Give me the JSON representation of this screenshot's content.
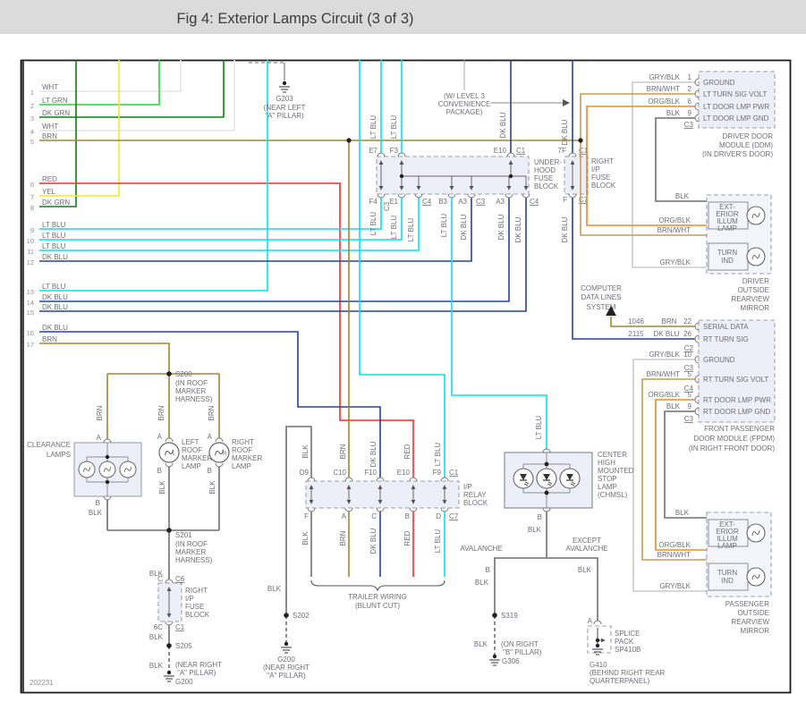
{
  "title": "Fig 4: Exterior Lamps Circuit (3 of 3)",
  "doc_number": "202231",
  "colors": {
    "wht": "#E4E4E4",
    "lt_grn": "#2FD23A",
    "dk_grn": "#0E7F17",
    "brn": "#A3862F",
    "red": "#F92C2C",
    "yel": "#F5E723",
    "lt_blu": "#00E4EE",
    "dk_blu": "#26419E",
    "blk": "#6F6F6F",
    "gry_blk": "#CACACA",
    "brn_wht": "#C79C52",
    "org_blk": "#E8882B",
    "panel": "#EDEFF8",
    "text": "#6E6E78"
  },
  "lbl": {
    "blk": "BLK",
    "brn": "BRN",
    "lt_blu": "LT BLU",
    "dk_blu": "DK BLU",
    "red": "RED"
  },
  "left_wires": [
    {
      "n": "1",
      "c": "WHT"
    },
    {
      "n": "2",
      "c": "LT GRN"
    },
    {
      "n": "3",
      "c": "DK GRN"
    },
    {
      "n": "4",
      "c": "WHT"
    },
    {
      "n": "5",
      "c": "BRN"
    },
    {
      "n": "6",
      "c": "RED"
    },
    {
      "n": "7",
      "c": "YEL"
    },
    {
      "n": "8",
      "c": "DK GRN"
    },
    {
      "n": "9",
      "c": "LT BLU"
    },
    {
      "n": "10",
      "c": "LT BLU"
    },
    {
      "n": "11",
      "c": "LT BLU"
    },
    {
      "n": "12",
      "c": "DK BLU"
    },
    {
      "n": "13",
      "c": "LT BLU"
    },
    {
      "n": "14",
      "c": "DK BLU"
    },
    {
      "n": "15",
      "c": "DK BLU"
    },
    {
      "n": "16",
      "c": "DK BLU"
    },
    {
      "n": "17",
      "c": "BRN"
    }
  ],
  "g203": {
    "name": "G203",
    "loc1": "(NEAR LEFT",
    "loc2": "\"A\" PILLAR)"
  },
  "level3": {
    "l1": "(W/ LEVEL 3",
    "l2": "CONVENIENCE",
    "l3": "PACKAGE)"
  },
  "uhfb": {
    "n1": "UNDER-",
    "n2": "HOOD",
    "n3": "FUSE",
    "n4": "BLOCK",
    "e7": "E7",
    "f3": "F3",
    "e10": "E10",
    "c1": "C1",
    "f4": "F4",
    "c3r": "C3",
    "e1": "E1",
    "c4a": "C4",
    "b3": "B3",
    "a3a": "A3",
    "c3b": "C3",
    "a3b": "A3",
    "c4b": "C4"
  },
  "rif": {
    "n1": "RIGHT",
    "n2": "I/P",
    "n3": "FUSE",
    "n4": "BLOCK",
    "t_pin": "7F",
    "t_conn": "C1",
    "b_pin": "F",
    "b_conn": "C7"
  },
  "rif2": {
    "t_pin": "C",
    "t_conn": "C6",
    "b_pin": "6C",
    "b_conn": "C1"
  },
  "ddm": {
    "pins": [
      {
        "w": "GRY/BLK",
        "p": "1",
        "f": "GROUND"
      },
      {
        "w": "BRN/WHT",
        "p": "2",
        "f": "LT TURN SIG VOLT"
      },
      {
        "w": "ORG/BLK",
        "p": "6",
        "f": "LT DOOR LMP PWR"
      },
      {
        "w": "BLK",
        "p": "9",
        "f": "LT DOOR LMP GND"
      }
    ],
    "conn": "C3",
    "n1": "DRIVER DOOR",
    "n2": "MODULE (DDM)",
    "n3": "(IN DRIVER'S DOOR)"
  },
  "mirror": {
    "lamp1": "EXT-",
    "lamp2": "ERIOR",
    "lamp3": "ILLUM",
    "lamp4": "LAMP",
    "turn1": "TURN",
    "turn2": "IND"
  },
  "driver_mirror": {
    "w1": "BLK",
    "w2": "ORG/BLK",
    "w3": "BRN/WHT",
    "w4": "GRY/BLK",
    "n1": "DRIVER",
    "n2": "OUTSIDE",
    "n3": "REARVIEW",
    "n4": "MIRROR"
  },
  "pass_mirror": {
    "w1": "BLK",
    "w2": "ORG/BLK",
    "w3": "BRN/WHT",
    "w4": "GRY/BLK",
    "n1": "PASSENGER",
    "n2": "OUTSIDE",
    "n3": "REARVIEW",
    "n4": "MIRROR"
  },
  "cdl": {
    "l1": "COMPUTER",
    "l2": "DATA LINES",
    "l3": "SYSTEM"
  },
  "fpdm": {
    "r1": {
      "ckt": "1046",
      "w": "BRN",
      "p": "22",
      "f": "SERIAL DATA"
    },
    "r2": {
      "ckt": "2115",
      "w": "DK BLU",
      "p": "26",
      "f": "RT TURN SIG"
    },
    "c2": "C2",
    "pins": [
      {
        "w": "GRY/BLK",
        "p": "10",
        "f": "GROUND",
        "conn": "C3"
      },
      {
        "w": "BRN/WHT",
        "p": "5",
        "f": "RT TURN SIG VOLT",
        "conn": "C4"
      },
      {
        "w": "ORG/BLK",
        "p": "5",
        "f": "RT DOOR LMP PWR",
        "conn": ""
      },
      {
        "w": "BLK",
        "p": "9",
        "f": "RT DOOR LMP GND",
        "conn": "C3"
      }
    ],
    "n1": "FRONT PASSENGER",
    "n2": "DOOR MODULE (FPDM)",
    "n3": "(IN RIGHT FRONT DOOR)"
  },
  "s200": {
    "name": "S200",
    "l1": "(IN ROOF",
    "l2": "MARKER",
    "l3": "HARNESS)"
  },
  "s201": {
    "name": "S201",
    "l1": "(IN ROOF",
    "l2": "MARKER",
    "l3": "HARNESS)"
  },
  "clearance": {
    "n1": "CLEARANCE",
    "n2": "LAMPS",
    "a": "A",
    "b": "B"
  },
  "lmarker": {
    "n1": "LEFT",
    "n2": "ROOF",
    "n3": "MARKER",
    "n4": "LAMP",
    "a": "A",
    "b": "B",
    "ltr": "L"
  },
  "rmarker": {
    "n1": "RIGHT",
    "n2": "ROOF",
    "n3": "MARKER",
    "n4": "LAMP",
    "a": "A",
    "b": "B",
    "ltr": "R"
  },
  "s205": "S205",
  "g200a": {
    "name": "G200",
    "l1": "(NEAR RIGHT",
    "l2": "\"A\" PILLAR)"
  },
  "g200b": {
    "name": "G200",
    "l1": "(NEAR RIGHT",
    "l2": "\"A\" PILLAR)"
  },
  "s202": "S202",
  "relay": {
    "n1": "I/P",
    "n2": "RELAY",
    "n3": "BLOCK",
    "t": [
      "D9",
      "C10",
      "F10",
      "E10",
      "F9"
    ],
    "tc": "C1",
    "b": [
      "F",
      "A",
      "C",
      "B",
      "D"
    ],
    "bc": "C7"
  },
  "trailer": {
    "l1": "TRAILER WIRING",
    "l2": "(BLUNT CUT)"
  },
  "chmsl": {
    "n1": "CENTER",
    "n2": "HIGH",
    "n3": "MOUNTED",
    "n4": "STOP",
    "n5": "LAMP",
    "n6": "(CHMSL)",
    "b": "B"
  },
  "branch": {
    "aval": "AVALANCHE",
    "ex1": "EXCEPT",
    "ex2": "AVALANCHE",
    "b": "B",
    "a": "A"
  },
  "s319": "S319",
  "g306": {
    "name": "G306",
    "l1": "(ON RIGHT",
    "l2": "\"B\" PILLAR)"
  },
  "splice": {
    "l1": "SPLICE",
    "l2": "PACK",
    "l3": "SP410B"
  },
  "g410": {
    "name": "G410",
    "l1": "(BEHIND RIGHT REAR",
    "l2": "QUARTERPANEL)"
  }
}
